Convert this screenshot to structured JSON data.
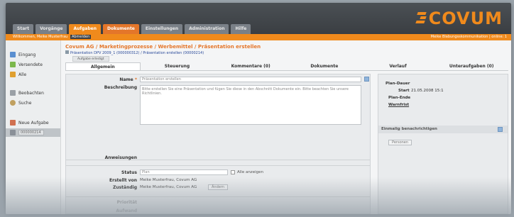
{
  "logo": {
    "text": "COVUM"
  },
  "nav": {
    "tabs": [
      "Start",
      "Vorgänge",
      "Aufgaben",
      "Dokumente",
      "Einstellungen",
      "Administration",
      "Hilfe"
    ],
    "active_index": 2
  },
  "status": {
    "welcome": "Willkommen, Meike Musterfrau",
    "tag": "Abmelden",
    "right": "Meike Blabungsskommunikation | online: 1"
  },
  "sidebar": {
    "items": [
      {
        "label": "Eingang",
        "icon": "inbox-icon"
      },
      {
        "label": "Versendete",
        "icon": "sent-icon"
      },
      {
        "label": "Alle",
        "icon": "all-icon"
      },
      {
        "label": "Beobachten",
        "icon": "watch-icon"
      },
      {
        "label": "Suche",
        "icon": "search-icon"
      },
      {
        "label": "Neue Aufgabe",
        "icon": "new-task-icon"
      }
    ],
    "selected_box": "000000214"
  },
  "page": {
    "title": "Covum AG / Marketingprozesse / Werbemittel / Präsentation erstellen",
    "breadcrumb": "Präsentation DPV 2009_1 (000000312) / Präsentation erstellen (00000214)",
    "small_tab": "Aufgabe erledigt"
  },
  "tabs": [
    "Allgemein",
    "Steuerung",
    "Kommentare (0)",
    "Dokumente",
    "Verlauf",
    "Unteraufgaben (0)"
  ],
  "form": {
    "name_label": "Name",
    "name_value": "Präsentation erstellen",
    "desc_label": "Beschreibung",
    "desc_value": "Bitte erstellen Sie eine Präsentation und fügen Sie diese in den Abschnitt Dokumente ein. Bitte beachten Sie unsere Richtlinien.",
    "anweisungen_label": "Anweisungen",
    "status_label": "Status",
    "status_value": "Plan",
    "alle_label": "Alle anzeigen",
    "erstellt_label": "Erstellt von",
    "erstellt_value": "Meike Musterfrau, Covum AG",
    "zustaendig_label": "Zuständig",
    "zustaendig_value": "Meike Musterfrau, Covum AG",
    "zustaendig_button": "Ändern",
    "prio_label": "Priorität",
    "row5_label": "Aufwand"
  },
  "right": {
    "plan_dauer": "Plan-Dauer",
    "start_label": "Start",
    "start_value": "21.05.2008 15:1",
    "plan_ende": "Plan-Ende",
    "warnfrist": "Warnfrist",
    "notify_header": "Einmalig benachrichtigen",
    "persons_button": "Personen"
  },
  "colors": {
    "accent": "#f08a1c",
    "header": "#3e4246"
  }
}
